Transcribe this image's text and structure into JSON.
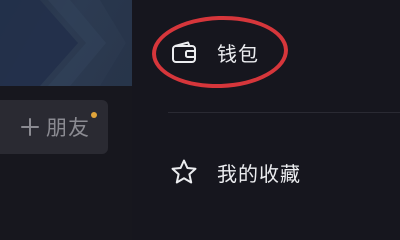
{
  "profile": {
    "add_friend_label": "朋友",
    "add_friend_icon": "plus-icon",
    "notification_dot_color": "#e0a43a"
  },
  "menu": {
    "items": [
      {
        "id": "wallet",
        "label": "钱包",
        "icon": "wallet-icon"
      },
      {
        "id": "favorites",
        "label": "我的收藏",
        "icon": "star-icon"
      }
    ]
  },
  "annotation": {
    "highlight_color": "#d6363b",
    "highlighted_item": "wallet"
  }
}
